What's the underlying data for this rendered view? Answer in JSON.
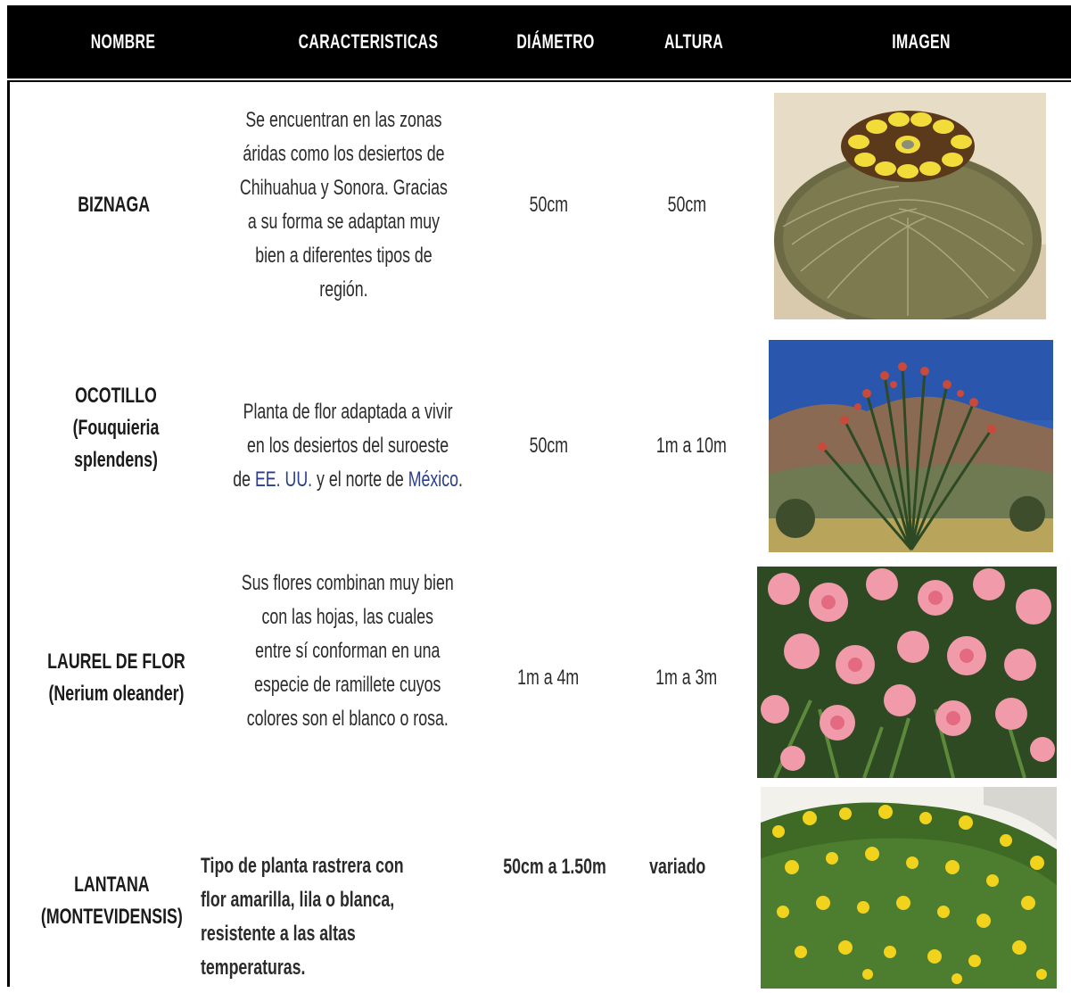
{
  "header": {
    "nombre": "NOMBRE",
    "caracteristicas": "CARACTERISTICAS",
    "diametro": "DIÁMETRO",
    "altura": "ALTURA",
    "imagen": "IMAGEN"
  },
  "rows": [
    {
      "nombre": "BIZNAGA",
      "caracteristicas_lines": [
        "Se encuentran en las zonas",
        "áridas como los desiertos de",
        "Chihuahua y Sonora. Gracias",
        "a su forma se adaptan muy",
        "bien a diferentes tipos de",
        "región."
      ],
      "diametro": "50cm",
      "altura": "50cm",
      "imagen": "cactus-photo"
    },
    {
      "nombre_lines": [
        "OCOTILLO (Fouquieria",
        "splendens)"
      ],
      "caracteristicas_lines": [
        "Planta de flor adaptada a vivir",
        "en los desiertos del suroeste"
      ],
      "caracteristicas_line3": {
        "pre": "de ",
        "link1": "EE. UU.",
        "mid": " y el norte de ",
        "link2": "México",
        "post": "."
      },
      "diametro": "50cm",
      "altura": "1m a 10m",
      "imagen": "ocotillo-photo"
    },
    {
      "nombre_lines": [
        "LAUREL DE FLOR",
        "(Nerium oleander)"
      ],
      "caracteristicas_lines": [
        "Sus flores combinan muy bien",
        "con las hojas, las cuales",
        "entre sí conforman en una",
        "especie de ramillete cuyos",
        "colores son el blanco o rosa."
      ],
      "diametro": "1m a 4m",
      "altura": "1m a 3m",
      "imagen": "oleander-photo"
    },
    {
      "nombre_lines": [
        "LANTANA",
        "(MONTEVIDENSIS)"
      ],
      "caracteristicas_lines": [
        "Tipo de planta rastrera con",
        "flor amarilla, lila o blanca,",
        "resistente a las altas",
        "temperaturas."
      ],
      "diametro": "50cm a 1.50m",
      "altura": "variado",
      "imagen": "lantana-photo"
    }
  ],
  "colors": {
    "header_bg": "#000000",
    "header_text": "#ffffff",
    "link_blue": "#2a3e8c"
  }
}
